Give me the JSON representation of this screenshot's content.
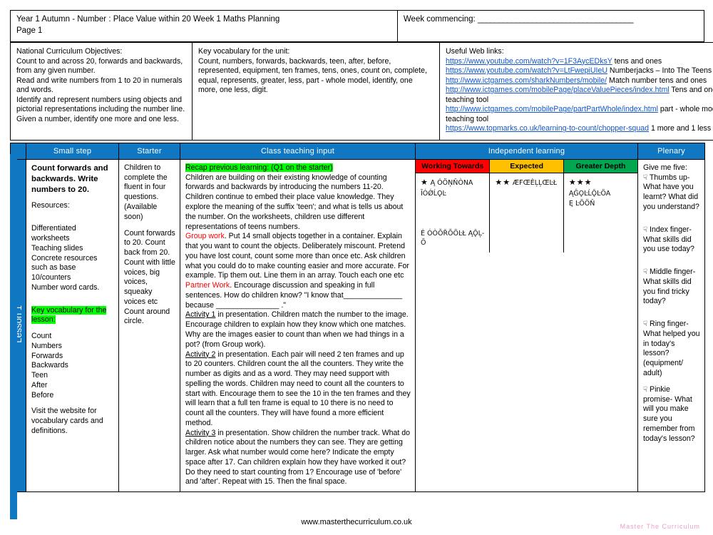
{
  "header": {
    "title_line1": "Year 1 Autumn -  Number : Place Value within 20 Week 1 Maths Planning",
    "title_line2": "Page 1",
    "week_commencing_label": "Week commencing:",
    "week_commencing_rule": "_____________________________________"
  },
  "info": {
    "nc": {
      "heading": "National Curriculum Objectives:",
      "lines": [
        "Count to and across 20, forwards and backwards, from any given number.",
        "Read and write numbers from 1 to 20 in numerals and words.",
        "Identify and represent numbers using objects and pictorial representations including the number line.",
        "Given a number, identify one more and one less."
      ]
    },
    "vocab": {
      "heading": "Key vocabulary for the unit:",
      "body": "Count, numbers, forwards, backwards, teen, after, before, represented, equipment, ten frames, tens, ones, count on, complete, equal, represents, greater, less, part - whole model, identify, one more, one less, digit."
    },
    "web": {
      "heading": "Useful Web links:",
      "links": [
        {
          "url": "https://www.youtube.com/watch?v=1F3AycEDksY",
          "note": " tens and ones"
        },
        {
          "url": "https://www.youtube.com/watch?v=LtFwepiUIeU",
          "note": "  Numberjacks – Into The Teens"
        },
        {
          "url": "http://www.ictgames.com/sharkNumbers/mobile/",
          "note": "  Match number tens and ones"
        },
        {
          "url": "http://www.ictgames.com/mobilePage/placeValuePieces/index.html",
          "note": " Tens and ones teaching tool"
        },
        {
          "url": "http://www.ictgames.com/mobilePage/partPartWhole/index.html",
          "note": " part - whole model teaching tool"
        },
        {
          "url": "https://www.topmarks.co.uk/learning-to-count/chopper-squad",
          "note": "  1 more and 1 less"
        }
      ]
    }
  },
  "table": {
    "columns": {
      "small_step": "Small step",
      "starter": "Starter",
      "class_teaching": "Class teaching input",
      "independent": "Independent learning",
      "plenary": "Plenary"
    },
    "lesson_tab": "Lesson 1",
    "small_step": {
      "objective": "Count forwards and backwards. Write numbers to 20.",
      "resources_label": "Resources:",
      "resources": [
        "Differentiated worksheets",
        "Teaching slides",
        "Concrete resources such as base 10/counters",
        "Number word cards."
      ],
      "vocab_heading": "Key vocabulary for the lesson:",
      "vocab_words": [
        "Count",
        "Numbers",
        "Forwards",
        "Backwards",
        "Teen",
        "After",
        "Before"
      ],
      "vocab_note": "Visit the website for vocabulary cards and definitions."
    },
    "starter": {
      "para1": "Children to complete the fluent in four questions. (Available soon)",
      "para2": "Count forwards to 20. Count back from 20. Count with little voices, big voices, squeaky voices etc Count around circle."
    },
    "class_teaching": {
      "recap_label": "Recap previous learning: (Q1 on the starter)",
      "recap_body": "Children are building on their existing knowledge of counting forwards and backwards by introducing the numbers 11-20. Children continue to embed their place value knowledge. They explore the meaning of the suffix 'teen'; and what is tells us about the number. On the worksheets, children use different representations of teens numbers.",
      "group_work_label": "Group work",
      "group_work_body": ". Put 14 small objects together in a container. Explain that you want to count the objects. Deliberately miscount. Pretend you have lost count, count some more than once etc. Ask children what you could do to make counting easier and more accurate. For example. Tip them out. Line them in an array. Touch each one etc",
      "partner_work_label": "Partner Work",
      "partner_work_body": ".  Encourage discussion and speaking in full sentences. How do children know?  \"I know that______________  because _______________ .\"",
      "activity1_label": "Activity 1",
      "activity1_body": " in presentation. Children match the number to the image. Encourage children to explain how they know which one matches. Why are the images easier to count than when we had things in a pot? (from Group work).",
      "activity2_label": "Activity 2",
      "activity2_body": " in presentation. Each pair will need 2 ten frames and up to 20 counters. Children count the all the counters. They write the number as digits and as a word. They may need support with spelling the words. Children may need to count all the counters to start with. Encourage them to see the 10 in the ten frames and they will learn that a full ten frame is equal to 10 there is no need to count all the counters. They will have found a more efficient method.",
      "activity3_label": "Activity 3",
      "activity3_body": " in presentation. Show children the number track.  What do children notice about the numbers they can see. They are getting larger. Ask what number would come here? Indicate the empty space after 17. Can children explain how they have worked it out? Do they need to start counting from 1? Encourage use of 'before' and 'after'. Repeat with 15. Then the final space."
    },
    "independent": [
      {
        "label": "Working Towards",
        "color": "#ff0000",
        "stars": "★",
        "text_line1": "Ą  ÓÖŅŇÒNA",
        "text_line2": "ĪÓǾĹǪĿ",
        "extra": "Ė ÓÒŎŘŎÖĿŁ ĄǬĻ-Ö"
      },
      {
        "label": "Expected",
        "color": "#ffc000",
        "stars": "★★",
        "text_line1": "ÆFŒĖĻĻŒĿŁ",
        "text_line2": "",
        "extra": ""
      },
      {
        "label": "Greater Depth",
        "color": "#00a650",
        "stars": "★★★",
        "text_line1": "ĄĜǪĿĹǬĿÖA",
        "text_line2": "Ę ĿÖÖŇ",
        "extra": ""
      }
    ],
    "plenary": {
      "heading": "Give me five:",
      "hand_icon": "☟",
      "items": [
        "Thumbs up- What have you learnt? What did you understand?",
        "Index finger- What skills did you use today?",
        "Middle finger- What skills did you find tricky today?",
        "Ring finger- What helped you in today's lesson? (equipment/ adult)",
        "Pinkie promise- What will you make sure you remember from today's lesson?"
      ]
    }
  },
  "footer": {
    "website": "www.masterthecurriculum.co.uk",
    "brand": "Master  The  Curriculum"
  }
}
